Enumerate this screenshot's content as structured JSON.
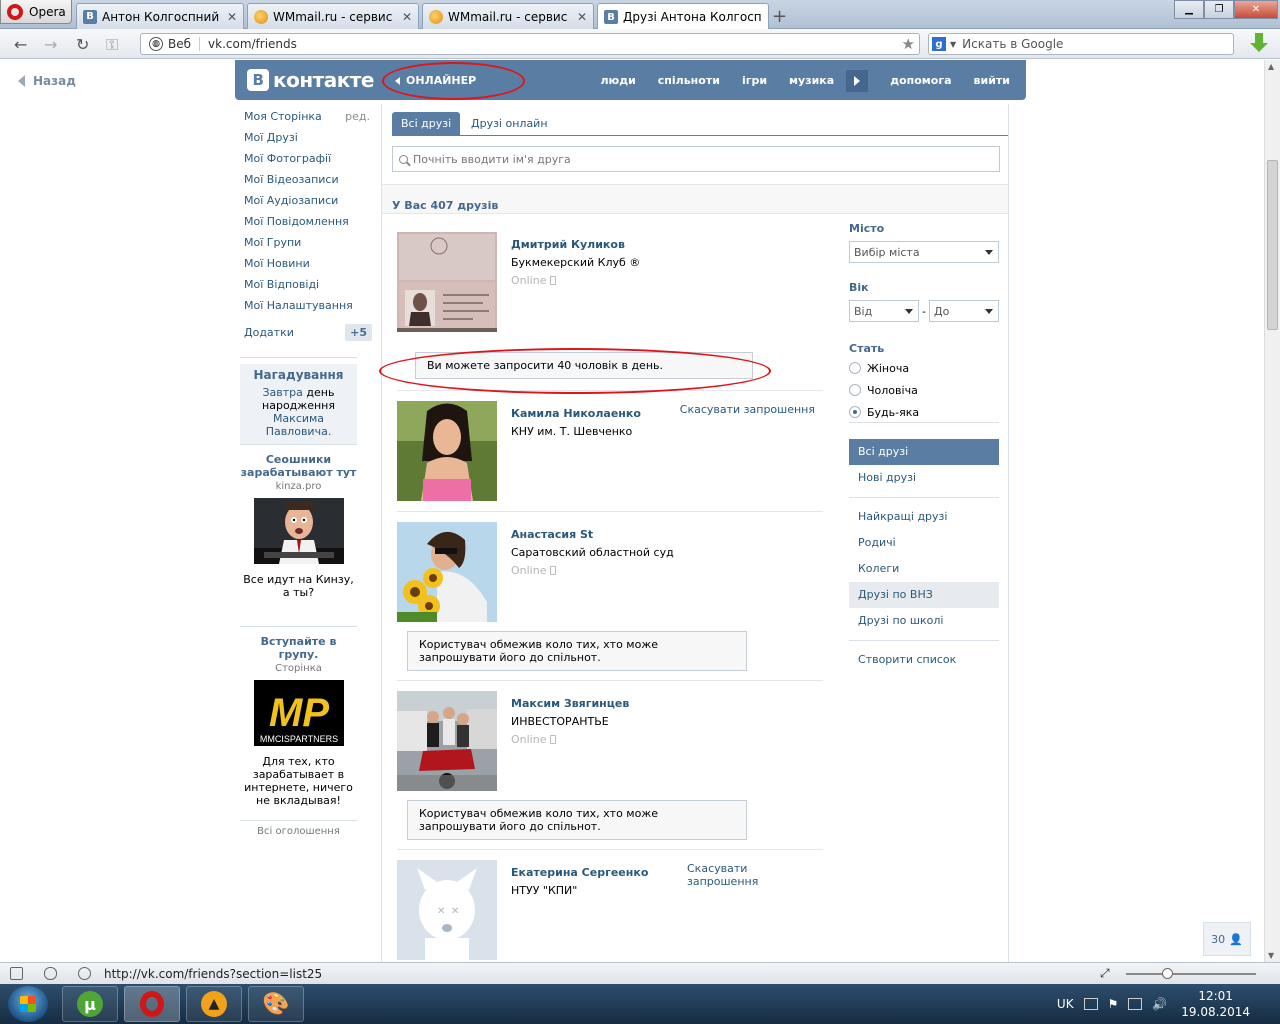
{
  "browser": {
    "opera_label": "Opera",
    "tabs": [
      {
        "title": "Антон Колгоспний",
        "icon": "vk-icon"
      },
      {
        "title": "WMmail.ru - сервис п...",
        "icon": "wmmail-icon"
      },
      {
        "title": "WMmail.ru - сервис п...",
        "icon": "wmmail-icon"
      },
      {
        "title": "Друзі Антона Колгосп...",
        "icon": "vk-icon"
      }
    ],
    "web_label": "Веб",
    "url": "vk.com/friends",
    "search_placeholder": "Искать в Google"
  },
  "page": {
    "back": "Назад",
    "logo": "контакте",
    "online": "ОНЛАЙНЕР",
    "menu": [
      "люди",
      "спільноти",
      "ігри",
      "музика",
      "допомога",
      "вийти"
    ],
    "left_menu": [
      "Моя Сторінка",
      "Мої Друзі",
      "Мої Фотографії",
      "Мої Відеозаписи",
      "Мої Аудіозаписи",
      "Мої Повідомлення",
      "Мої Групи",
      "Мої Новини",
      "Мої Відповіді",
      "Мої Налаштування"
    ],
    "edit": "ред.",
    "apps": "Додатки",
    "apps_badge": "+5",
    "reminder": {
      "title": "Нагадування",
      "tomorrow": "Завтра",
      "text": "день народження",
      "person": "Максима Павловича."
    },
    "ads": [
      {
        "title": "Сеошники зарабатывают тут",
        "domain": "kinza.pro",
        "text": "Все идут на Кинзу, а ты?"
      },
      {
        "title": "Вступайте в групу.",
        "domain": "Сторінка",
        "text": "Для тех, кто зарабатывает в интернете, ничего не вкладывая!",
        "logo": "MP",
        "logo_sub": "MMCISPARTNERS"
      }
    ],
    "all_ads": "Всі оголошення",
    "tabs": [
      "Всі друзі",
      "Друзі онлайн"
    ],
    "search_placeholder": "Почніть вводити ім'я друга",
    "count": "У Вас 407 друзів",
    "invite_notice": "Ви можете запросити 40 чоловік в день.",
    "restrict_notice": "Користувач обмежив коло тих, хто може запрошувати його до спільнот.",
    "friends": [
      {
        "name": "Дмитрий Куликов",
        "sub": "Букмекерский Клуб ®",
        "online": "Online"
      },
      {
        "name": "Камила Николаенко",
        "sub": "КНУ им. Т. Шевченко",
        "cancel": "Скасувати запрошення"
      },
      {
        "name": "Анастасия St",
        "sub": "Саратовский областной суд",
        "online": "Online"
      },
      {
        "name": "Максим Звягинцев",
        "sub": "ИНВЕСТОРАНТЬЕ",
        "online": "Online"
      },
      {
        "name": "Екатерина Сергеенко",
        "sub": "НТУУ \"КПИ\"",
        "cancel": "Скасувати запрошення"
      }
    ],
    "filters": {
      "city_label": "Місто",
      "city_placeholder": "Вибір міста",
      "age_label": "Вік",
      "age_from": "Від",
      "age_dash": "-",
      "age_to": "До",
      "sex_label": "Стать",
      "sex_options": [
        "Жіноча",
        "Чоловіча",
        "Будь-яка"
      ],
      "lists": [
        "Всі друзі",
        "Нові друзі",
        "Найкращі друзі",
        "Родичі",
        "Колеги",
        "Друзі по ВНЗ",
        "Друзі по школі",
        "Створити список"
      ]
    },
    "chat_count": "30"
  },
  "status": {
    "url": "http://vk.com/friends?section=list25",
    "lang": "UK",
    "time": "12:01",
    "date": "19.08.2014"
  },
  "colors": {
    "vk_blue": "#597da3",
    "link": "#2b587a",
    "annotation": "#e0141b"
  }
}
